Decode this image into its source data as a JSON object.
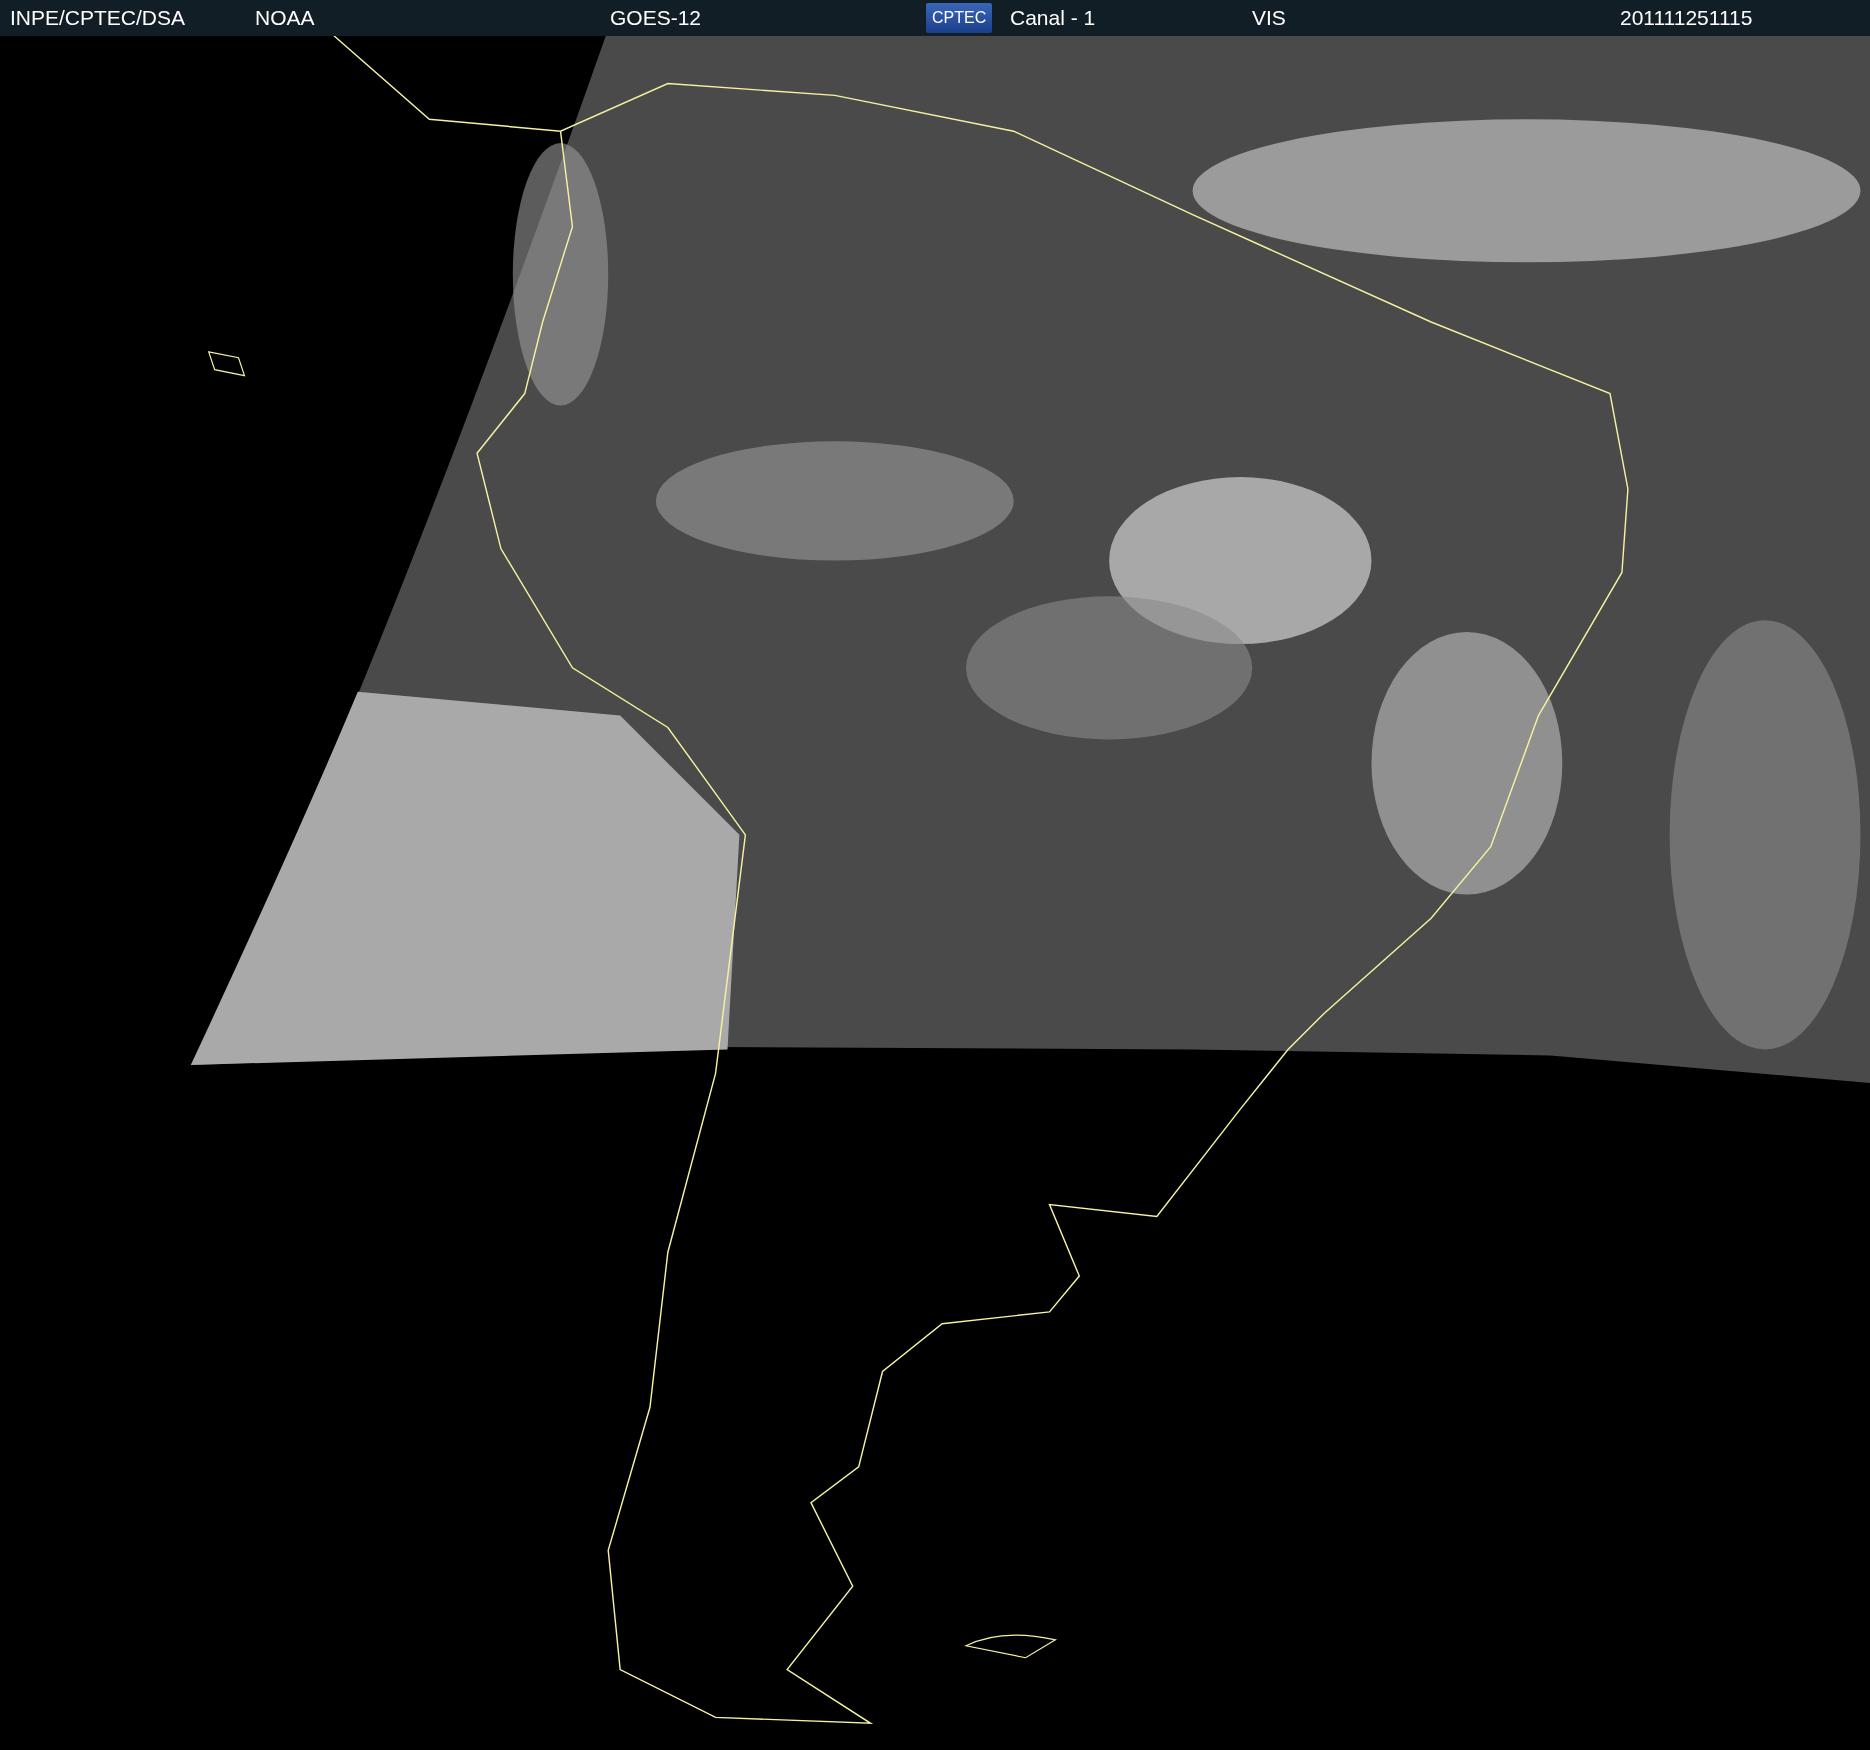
{
  "header": {
    "items": [
      {
        "kind": "text",
        "text": "INPE/CPTEC/DSA"
      },
      {
        "kind": "text",
        "text": "NOAA"
      },
      {
        "kind": "text",
        "text": "GOES-12"
      },
      {
        "kind": "logo",
        "text": "CPTEC"
      },
      {
        "kind": "text",
        "text": "Canal - 1"
      },
      {
        "kind": "text",
        "text": "VIS"
      },
      {
        "kind": "text",
        "text": "201111251115"
      }
    ]
  }
}
